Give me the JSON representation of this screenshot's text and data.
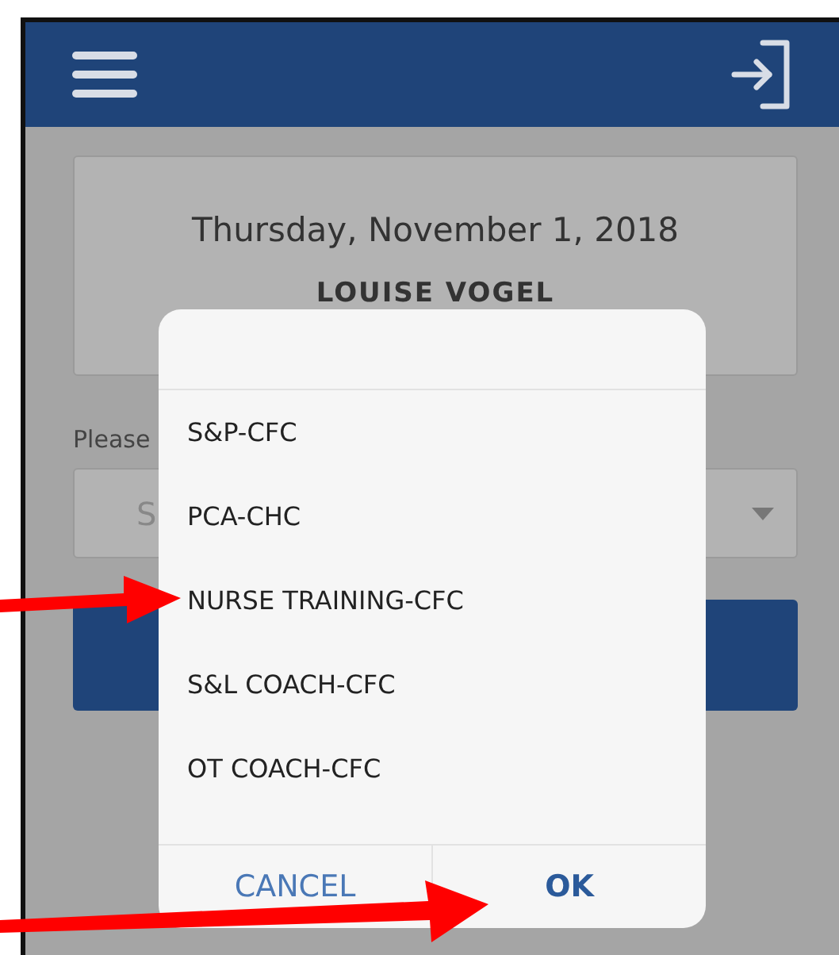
{
  "card": {
    "date": "Thursday, November 1, 2018",
    "name": "LOUISE VOGEL"
  },
  "form": {
    "label": "Please",
    "select": {
      "placeholder": "S"
    }
  },
  "dialog": {
    "options": [
      {
        "label": "S&P-CFC"
      },
      {
        "label": "PCA-CHC"
      },
      {
        "label": "NURSE TRAINING-CFC"
      },
      {
        "label": "S&L COACH-CFC"
      },
      {
        "label": "OT COACH-CFC"
      }
    ],
    "buttons": [
      {
        "label": "CANCEL",
        "kind": "secondary"
      },
      {
        "label": "OK",
        "kind": "primary"
      }
    ]
  }
}
